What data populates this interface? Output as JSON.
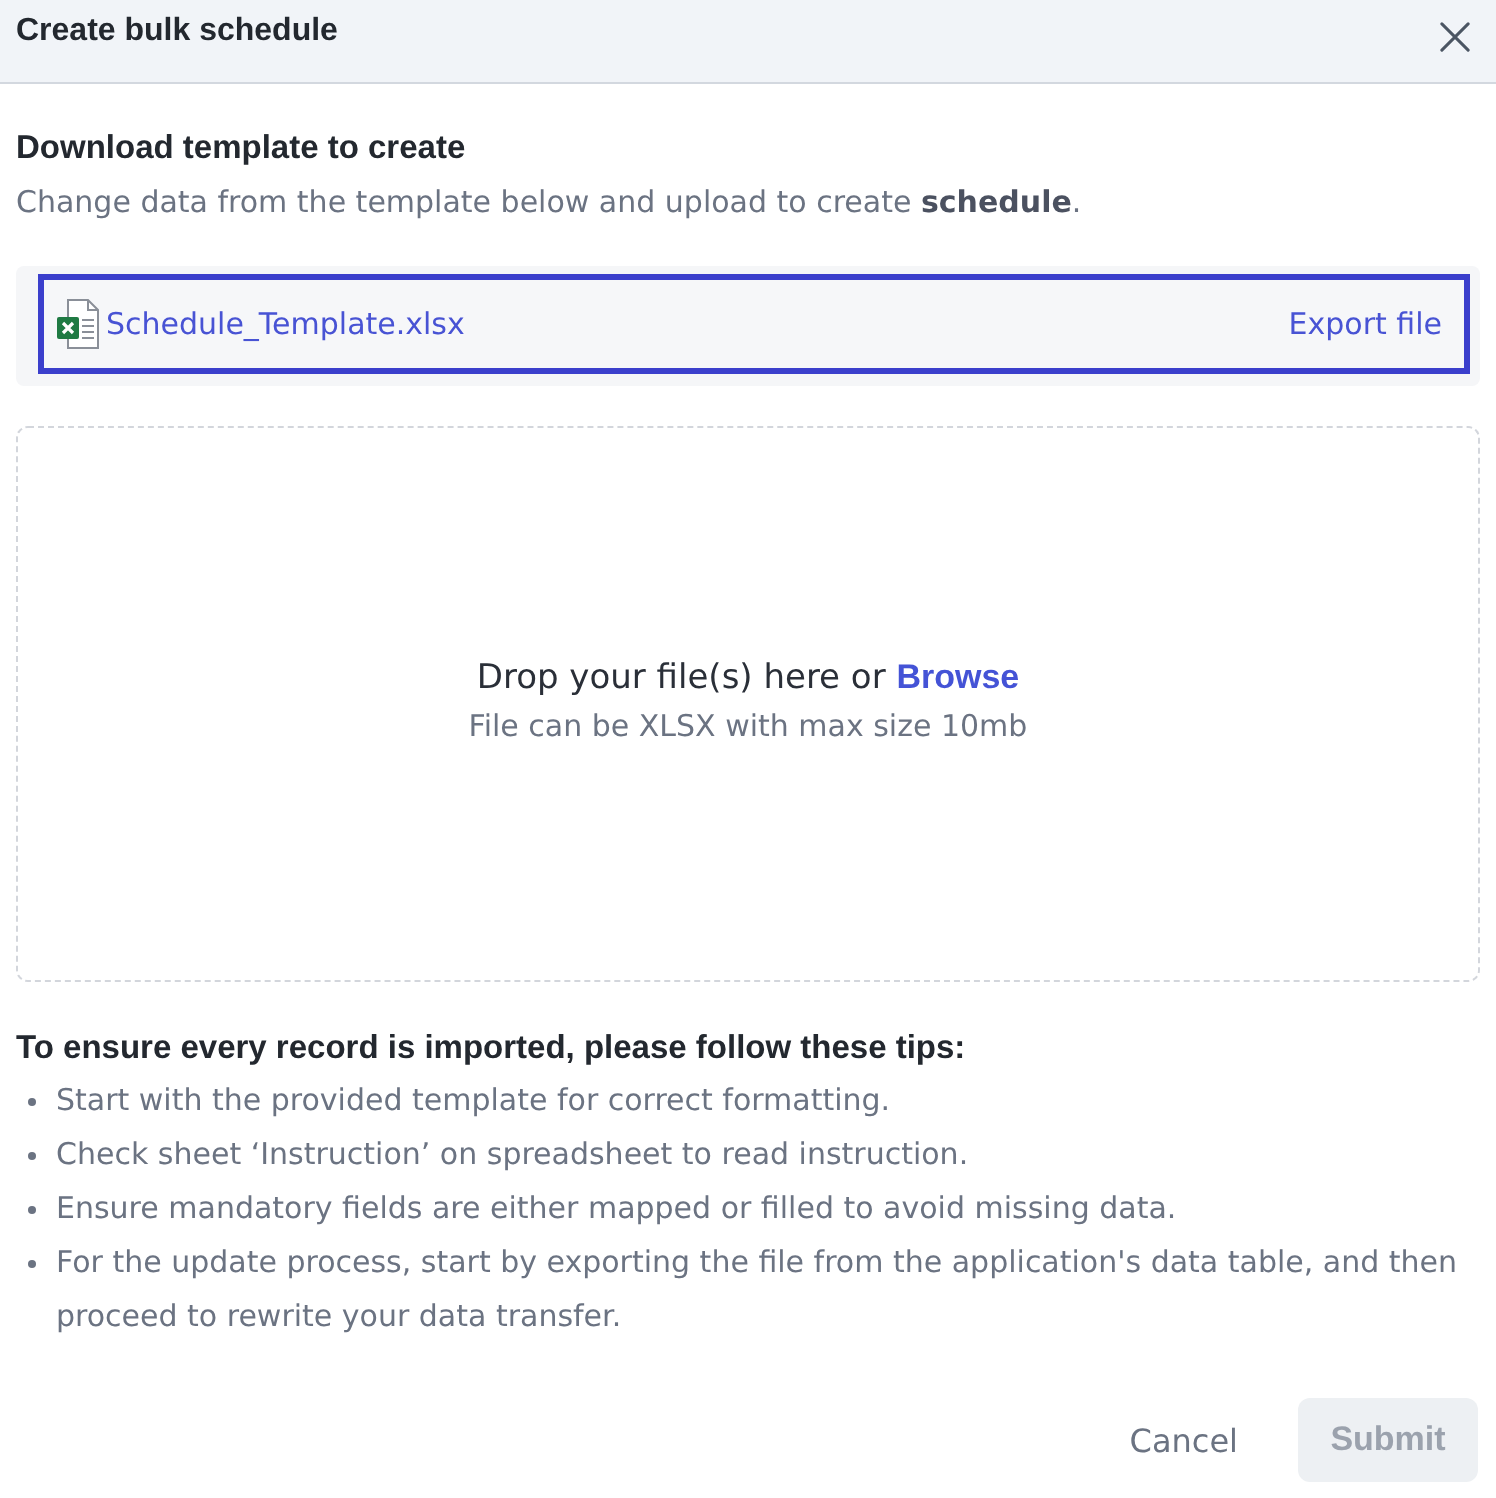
{
  "dialog": {
    "title": "Create bulk schedule"
  },
  "template": {
    "heading": "Download template to create",
    "description": "Change data from the template below and upload to create **schedule**.",
    "file": {
      "name": "Schedule_Template.xlsx",
      "focused": true
    },
    "export_label": "Export file"
  },
  "dropzone": {
    "prompt": "Drop your file(s) here or",
    "browse_label": "Browse",
    "hint": "File can be XLSX with max size 10mb"
  },
  "tips": {
    "heading": "To ensure every record is imported, please follow these tips:",
    "items": [
      "Start with the provided template for correct formatting.",
      "Check sheet ‘Instruction’ on spreadsheet to read instruction.",
      "Ensure mandatory fields are either mapped or filled to avoid missing data.",
      "For the update process, start by exporting the file from the application's data table, and then proceed to rewrite your data transfer."
    ]
  },
  "footer": {
    "buttons": [
      {
        "label": "Cancel",
        "kind": "text",
        "disabled": false
      },
      {
        "label": "Submit",
        "kind": "primary",
        "disabled": true
      }
    ]
  }
}
